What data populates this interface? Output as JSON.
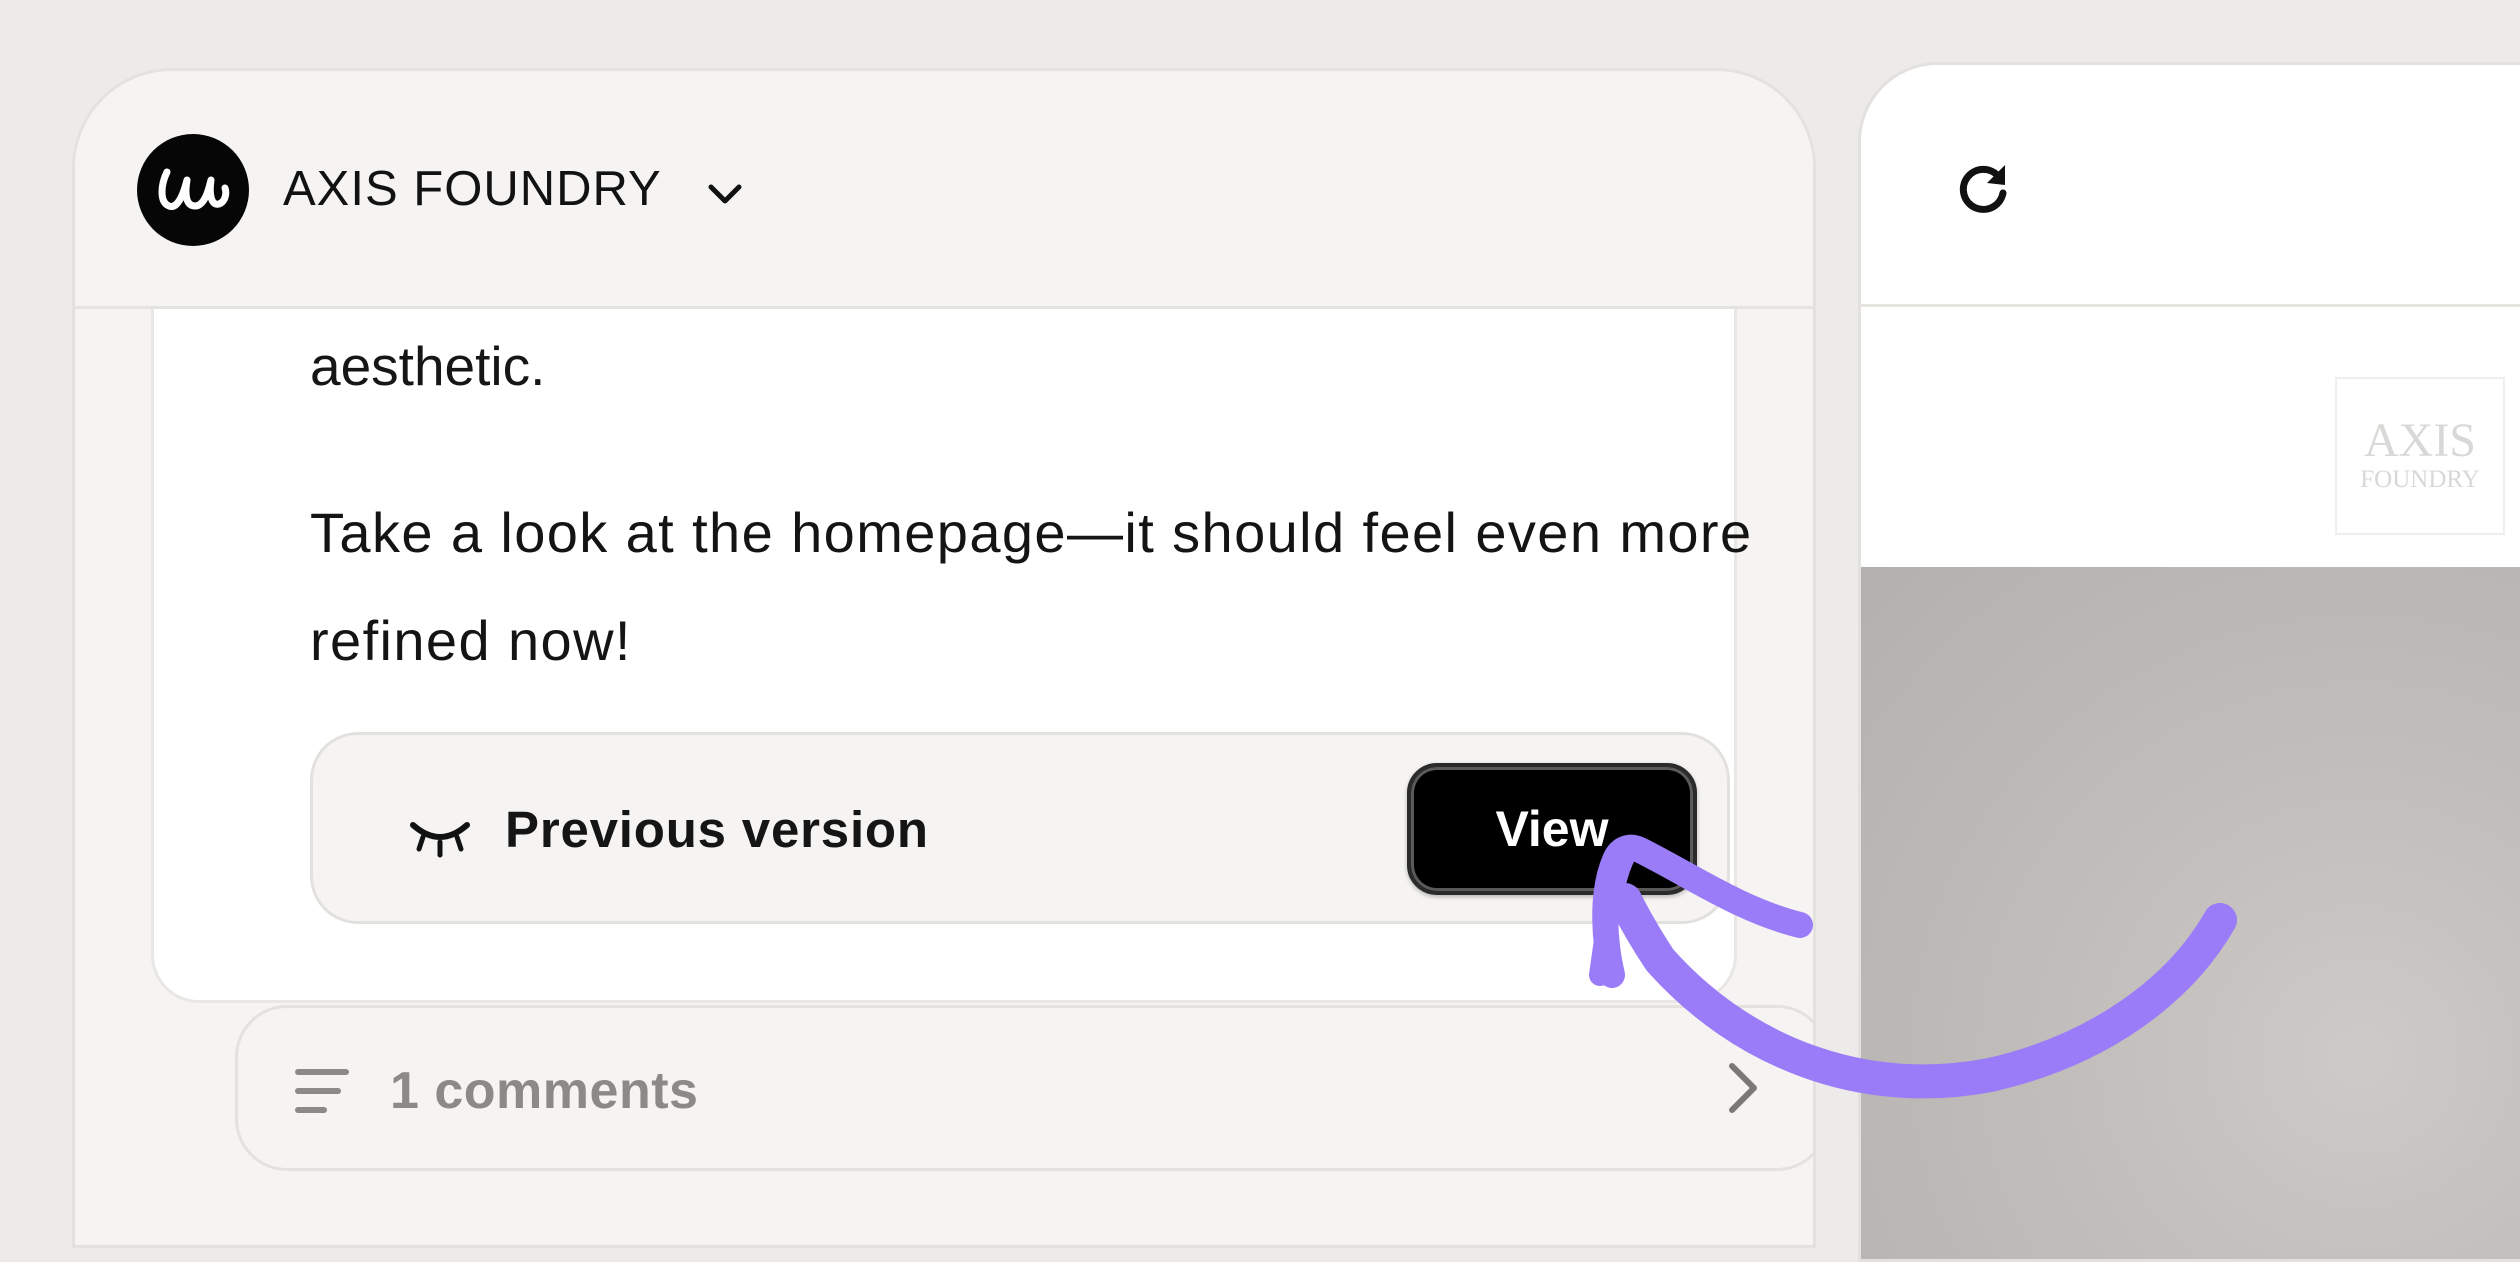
{
  "workspace": {
    "name": "AXIS FOUNDRY",
    "logo_icon": "script-w-logo"
  },
  "message": {
    "cut_off_text": "aesthetic.",
    "body": "Take a look at the homepage—it should feel even more refined now!"
  },
  "version_card": {
    "label": "Previous version",
    "icon": "closed-eye-icon",
    "button_label": "View"
  },
  "comments": {
    "label": "1 comments",
    "icon": "lines-icon"
  },
  "preview": {
    "refresh_icon": "refresh-icon",
    "site_logo_line1": "AXIS",
    "site_logo_line2": "FOUNDRY"
  },
  "colors": {
    "background": "#ecebe9",
    "panel": "#f5f4f2",
    "button": "#000000",
    "annotation": "#9b7cf8"
  }
}
